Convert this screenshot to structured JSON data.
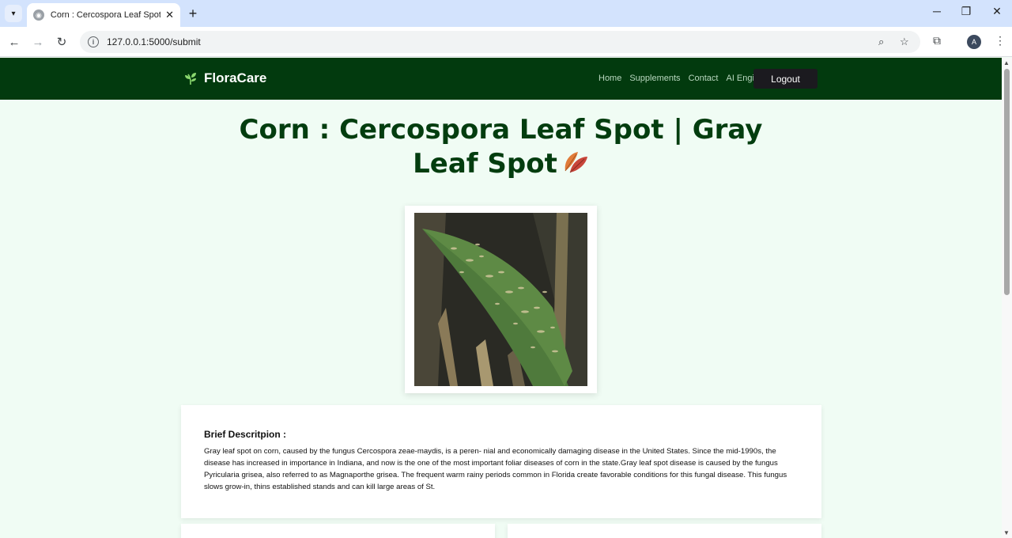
{
  "browser": {
    "tab_title": "Corn : Cercospora Leaf Spot | G",
    "tab_close": "✕",
    "new_tab": "+",
    "url": "127.0.0.1:5000/submit",
    "profile_initial": "A",
    "minimize": "─",
    "restore": "❐",
    "close": "✕"
  },
  "navbar": {
    "brand": "FloraCare",
    "links": [
      "Home",
      "Supplements",
      "Contact",
      "AI Engine"
    ],
    "logout": "Logout"
  },
  "page": {
    "title": "Corn : Cercospora Leaf Spot | Gray Leaf Spot",
    "description_heading": "Brief Descritpion :",
    "description": "Gray leaf spot on corn, caused by the fungus Cercospora zeae-maydis, is a peren- nial and economically damaging disease in the United States. Since the mid-1990s, the disease has increased in importance in Indiana, and now is the one of the most important foliar diseases of corn in the state.Gray leaf spot disease is caused by the fungus Pyricularia grisea, also referred to as Magnaporthe grisea. The frequent warm rainy periods common in Florida create favorable conditions for this fungal disease. This fungus slows grow-in, thins established stands and can kill large areas of St."
  },
  "colors": {
    "navbar": "#023a0e",
    "page_bg": "#f0fcf4",
    "headline": "#033d0f",
    "logout_bg": "#1b1a1f"
  }
}
